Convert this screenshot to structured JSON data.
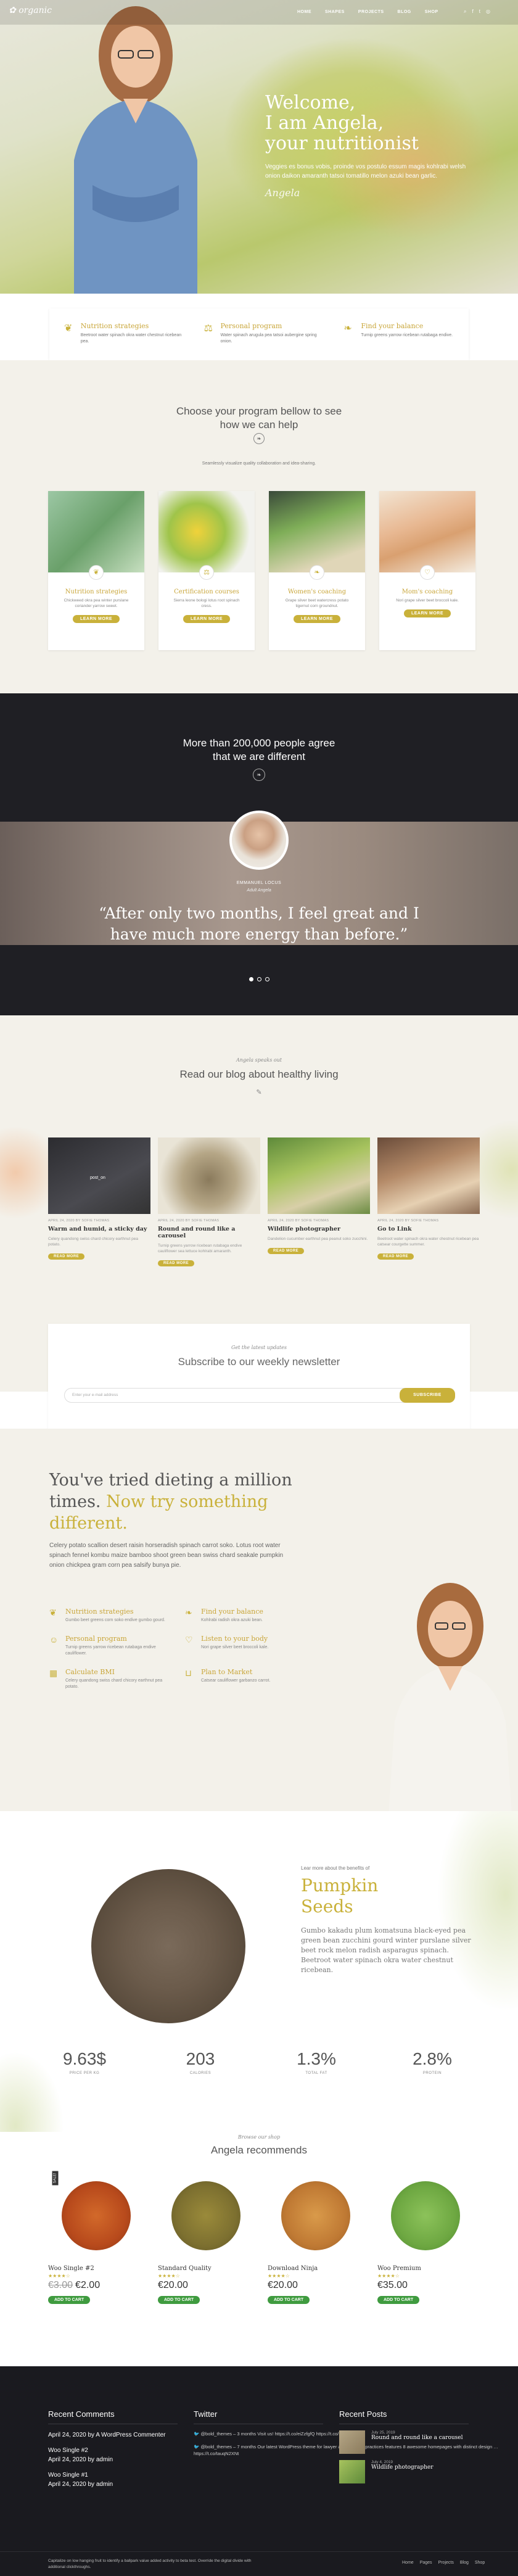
{
  "nav": {
    "logo": "organic",
    "items": [
      "HOME",
      "SHAPES",
      "PROJECTS",
      "BLOG",
      "SHOP"
    ],
    "social": [
      "search-icon",
      "facebook-icon",
      "twitter-icon",
      "instagram-icon"
    ]
  },
  "hero": {
    "title_line1": "Welcome,",
    "title_line2": "I am Angela,",
    "title_line3": "your nutritionist",
    "text": "Veggies es bonus vobis, proinde vos postulo essum magis kohlrabi welsh onion daikon amaranth tatsoi tomatillo melon azuki bean garlic.",
    "signature": "Angela"
  },
  "features": [
    {
      "title": "Nutrition strategies",
      "text": "Beetroot water spinach okra water chestnut ricebean pea."
    },
    {
      "title": "Personal program",
      "text": "Water spinach arugula pea tatsoi aubergine spring onion."
    },
    {
      "title": "Find your balance",
      "text": "Turnip greens yarrow ricebean rutabaga endive."
    }
  ],
  "program": {
    "title_line1": "Choose your program bellow to see",
    "title_line2": "how we can help",
    "subtitle": "Seamlessly visualize quality collaboration and idea-sharing.",
    "cards": [
      {
        "title": "Nutrition strategies",
        "text": "Chickweed okra pea winter purslane coriander yarrow sweet.",
        "button": "LEARN MORE"
      },
      {
        "title": "Certification courses",
        "text": "Sierra leone bologi lotus root spinach cress.",
        "button": "LEARN MORE"
      },
      {
        "title": "Women's coaching",
        "text": "Grape silver beet watercress potato tigernut corn groundnut.",
        "button": "LEARN MORE"
      },
      {
        "title": "Mom's coaching",
        "text": "Nori grape silver beet broccoli kale.",
        "button": "LEARN MORE"
      }
    ]
  },
  "testimonial": {
    "title_line1": "More than 200,000 people agree",
    "title_line2": "that we are different",
    "name": "EMMANUEL LOCUS",
    "role": "Adult Angela",
    "quote_line1": "“After only two months, I feel great and I",
    "quote_line2": "have much more energy than before.”"
  },
  "blog": {
    "kicker": "Angela speaks out",
    "title": "Read our blog about healthy living",
    "posts": [
      {
        "meta": "APRIL 24, 2020  BY SOFIE THOMAS",
        "title": "Warm and humid, a sticky day",
        "text": "Celery quandong swiss chard chicory earthnut pea potato.",
        "button": "READ MORE",
        "overlay": "post_on"
      },
      {
        "meta": "APRIL 24, 2020  BY SOFIE THOMAS",
        "title": "Round and round like a carousel",
        "text": "Turnip greens yarrow ricebean rutabaga endive cauliflower sea lettuce kohlrabi amaranth.",
        "button": "READ MORE",
        "overlay": ""
      },
      {
        "meta": "APRIL 24, 2020  BY SOFIE THOMAS",
        "title": "Wildlife photographer",
        "text": "Dandelion cucumber earthnut pea peanut soko zucchini.",
        "button": "READ MORE",
        "overlay": ""
      },
      {
        "meta": "APRIL 24, 2020  BY SOFIE THOMAS",
        "title": "Go to Link",
        "text": "Beetroot water spinach okra water chestnut ricebean pea catsear courgette summer.",
        "button": "READ MORE",
        "overlay": ""
      }
    ]
  },
  "newsletter": {
    "kicker": "Get the latest updates",
    "title": "Subscribe to our weekly newsletter",
    "placeholder": "Enter your e-mail address",
    "button": "SUBSCRIBE"
  },
  "diet": {
    "title_line1": "You've tried dieting a million",
    "title_line2": "times.",
    "title_highlight1": "Now try something",
    "title_highlight2": "different.",
    "intro": "Celery potato scallion desert raisin horseradish spinach carrot soko. Lotus root water spinach fennel kombu maize bamboo shoot green bean swiss chard seakale pumpkin onion chickpea gram corn pea salsify bunya pie.",
    "items": [
      {
        "title": "Nutrition strategies",
        "text": "Gumbo beet greens corn soko endive gumbo gourd."
      },
      {
        "title": "Find your balance",
        "text": "Kohlrabi radish okra azuki bean."
      },
      {
        "title": "Personal program",
        "text": "Turnip greens yarrow ricebean rutabaga endive cauliflower."
      },
      {
        "title": "Listen to your body",
        "text": "Nori grape silver beet broccoli kale."
      },
      {
        "title": "Calculate BMI",
        "text": "Celery quandong swiss chard chicory earthnut pea potato."
      },
      {
        "title": "Plan to Market",
        "text": "Catsear cauliflower garbanzo carrot."
      }
    ]
  },
  "pumpkin": {
    "kicker": "Lear more about the benefits of",
    "title_line1": "Pumpkin",
    "title_line2": "Seeds",
    "text": "Gumbo kakadu plum komatsuna black-eyed pea green bean zucchini gourd winter purslane silver beet rock melon radish asparagus spinach. Beetroot water spinach okra water chestnut ricebean.",
    "stats": [
      {
        "value": "9.63$",
        "label": "PRICE PER KG"
      },
      {
        "value": "203",
        "label": "CALORIES"
      },
      {
        "value": "1.3%",
        "label": "TOTAL FAT"
      },
      {
        "value": "2.8%",
        "label": "PROTEIN"
      }
    ]
  },
  "shop": {
    "kicker": "Browse our shop",
    "title": "Angela recommends",
    "products": [
      {
        "name": "Woo Single #2",
        "old_price": "€3.00",
        "price": "€2.00",
        "stars": "★★★★☆",
        "button": "ADD TO CART",
        "sale": "SALE!"
      },
      {
        "name": "Standard Quality",
        "old_price": "",
        "price": "€20.00",
        "stars": "★★★★☆",
        "button": "ADD TO CART",
        "sale": ""
      },
      {
        "name": "Download Ninja",
        "old_price": "",
        "price": "€20.00",
        "stars": "★★★★☆",
        "button": "ADD TO CART",
        "sale": ""
      },
      {
        "name": "Woo Premium",
        "old_price": "",
        "price": "€35.00",
        "stars": "★★★★☆",
        "button": "ADD TO CART",
        "sale": ""
      }
    ]
  },
  "footer": {
    "comments_title": "Recent Comments",
    "comments": [
      {
        "date": "April 24, 2020",
        "by": "by A WordPress Commenter"
      },
      {
        "date": "April 24, 2020",
        "by": "by admin",
        "title": "Woo Single #2"
      },
      {
        "date": "April 24, 2020",
        "by": "by admin",
        "title": "Woo Single #1"
      }
    ],
    "twitter_title": "Twitter",
    "tweets": [
      "@bold_themes – 3 months Visit us! https://t.co/eiZzfgfQ https://t.co/Ig5BFOHIaJ",
      "@bold_themes – 7 months Our latest WordPress theme for lawyer and attorney practices features 8 awesome homepages with distinct design … https://t.co/tauqN2XNt"
    ],
    "posts_title": "Recent Posts",
    "recent_posts": [
      {
        "date": "July 25, 2019",
        "title": "Round and round like a carousel"
      },
      {
        "date": "July 4, 2019",
        "title": "Wildlife photographer"
      }
    ],
    "copyright": "Capitalize on low hanging fruit to identify a ballpark value added activity to beta test. Override the digital divide with additional clickthroughs.",
    "nav": [
      "Home",
      "Pages",
      "Projects",
      "Blog",
      "Shop"
    ]
  }
}
